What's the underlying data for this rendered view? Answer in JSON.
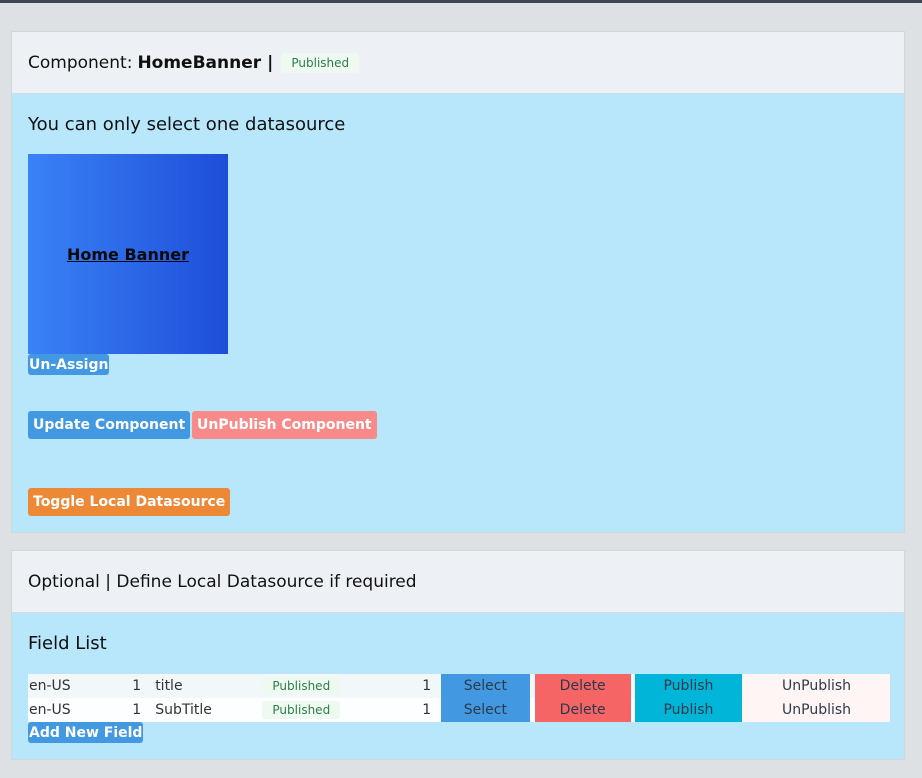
{
  "component": {
    "label": "Component:",
    "name": "HomeBanner",
    "separator": "|",
    "status": "Published",
    "select_note": "You can only select one datasource",
    "tile_label": "Home Banner",
    "unassign_label": "Un-Assign",
    "update_label": "Update Component",
    "unpublish_label": "UnPublish Component",
    "toggle_label": "Toggle Local Datasource"
  },
  "local": {
    "header": "Optional | Define Local Datasource if required",
    "field_list_title": "Field List",
    "add_field_label": "Add New Field",
    "rows": [
      {
        "locale": "en-US",
        "version": "1",
        "field": "title",
        "status": "Published",
        "count": "1",
        "select": "Select",
        "delete": "Delete",
        "publish": "Publish",
        "unpublish": "UnPublish"
      },
      {
        "locale": "en-US",
        "version": "1",
        "field": "SubTitle",
        "status": "Published",
        "count": "1",
        "select": "Select",
        "delete": "Delete",
        "publish": "Publish",
        "unpublish": "UnPublish"
      }
    ]
  },
  "colors": {
    "card_body": "#b8e6fb",
    "card_header": "#edf1f5",
    "primary": "#4299e1",
    "danger": "#f98a8a",
    "warning": "#ed8936",
    "info": "#00b5d8"
  }
}
